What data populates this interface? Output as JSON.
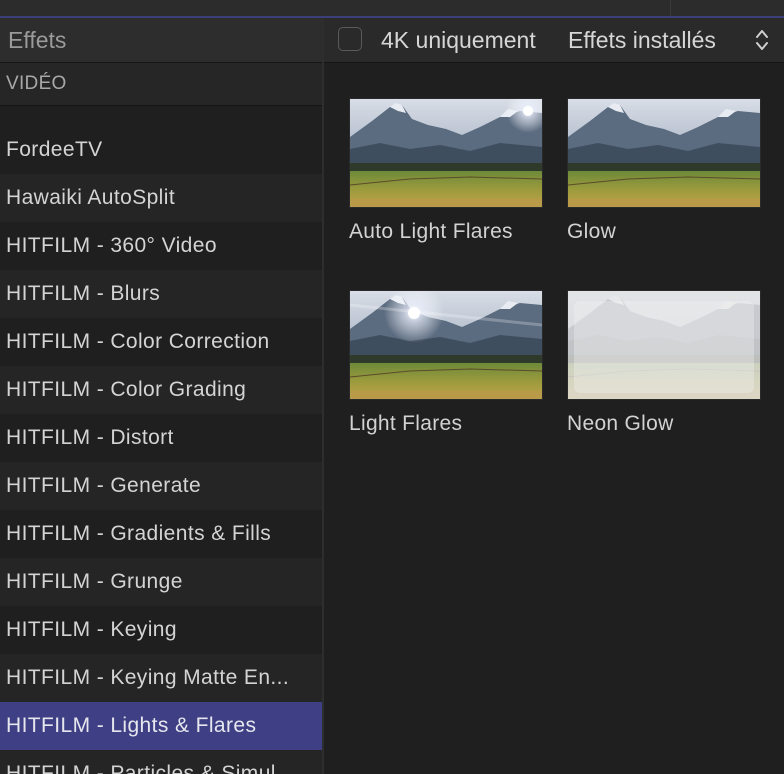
{
  "sidebar": {
    "title": "Effets",
    "section": "VIDÉO",
    "items": [
      {
        "label": "FordeeTV"
      },
      {
        "label": "Hawaiki AutoSplit"
      },
      {
        "label": "HITFILM - 360° Video"
      },
      {
        "label": "HITFILM - Blurs"
      },
      {
        "label": "HITFILM - Color Correction"
      },
      {
        "label": "HITFILM - Color Grading"
      },
      {
        "label": "HITFILM - Distort"
      },
      {
        "label": "HITFILM - Generate"
      },
      {
        "label": "HITFILM - Gradients & Fills"
      },
      {
        "label": "HITFILM - Grunge"
      },
      {
        "label": "HITFILM - Keying"
      },
      {
        "label": "HITFILM - Keying Matte En..."
      },
      {
        "label": "HITFILM - Lights & Flares",
        "selected": true
      },
      {
        "label": "HITFILM - Particles & Simul..."
      }
    ]
  },
  "header": {
    "checkbox_label": "4K uniquement",
    "checkbox_checked": false,
    "filter_label": "Effets installés"
  },
  "effects": [
    {
      "label": "Auto Light Flares",
      "icon": "thumbnail-landscape-flare"
    },
    {
      "label": "Glow",
      "icon": "thumbnail-landscape"
    },
    {
      "label": "Light Flares",
      "icon": "thumbnail-landscape-flare"
    },
    {
      "label": "Neon Glow",
      "icon": "thumbnail-landscape-washed"
    }
  ],
  "colors": {
    "selection": "#3e3f84",
    "background": "#1f1f1f"
  }
}
